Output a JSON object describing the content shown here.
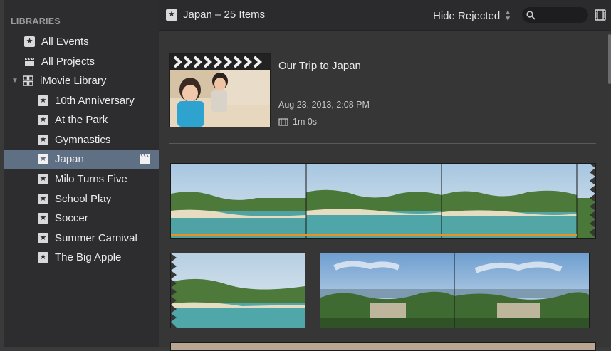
{
  "sidebar": {
    "header": "LIBRARIES",
    "items": [
      {
        "label": "All Events",
        "icon": "star-icon"
      },
      {
        "label": "All Projects",
        "icon": "clapper-icon"
      },
      {
        "label": "iMovie Library",
        "icon": "grid-icon"
      },
      {
        "label": "10th Anniversary",
        "icon": "star-icon"
      },
      {
        "label": "At the Park",
        "icon": "star-icon"
      },
      {
        "label": "Gymnastics",
        "icon": "star-icon"
      },
      {
        "label": "Japan",
        "icon": "star-icon",
        "selected": true
      },
      {
        "label": "Milo Turns Five",
        "icon": "star-icon"
      },
      {
        "label": "School Play",
        "icon": "star-icon"
      },
      {
        "label": "Soccer",
        "icon": "star-icon"
      },
      {
        "label": "Summer Carnival",
        "icon": "star-icon"
      },
      {
        "label": "The Big Apple",
        "icon": "star-icon"
      }
    ]
  },
  "topbar": {
    "title": "Japan – 25 Items",
    "filter_label": "Hide Rejected",
    "search_placeholder": ""
  },
  "project": {
    "title": "Our Trip to Japan",
    "date": "Aug 23, 2013, 2:08 PM",
    "duration": "1m 0s"
  },
  "colors": {
    "selection": "#5f6f84",
    "sidebar_bg": "#2d2d2f",
    "content_bg": "#363636",
    "favorite_bar": "#e8931f"
  }
}
